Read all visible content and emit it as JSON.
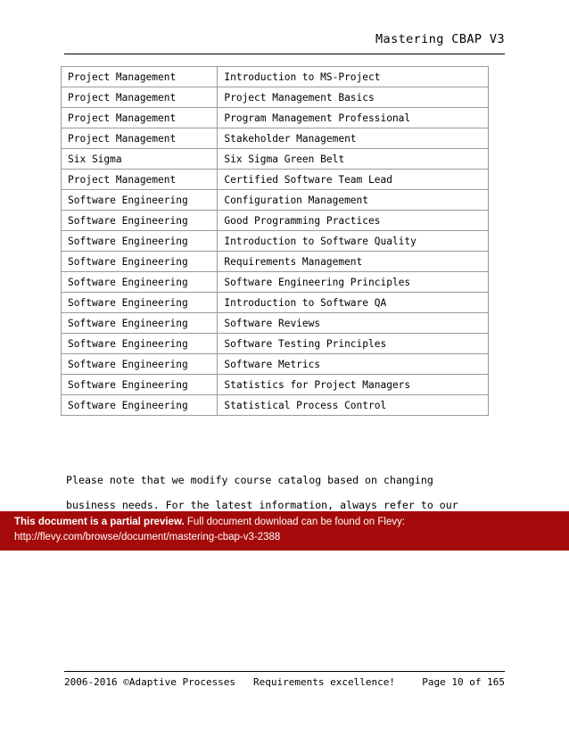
{
  "header": {
    "title": "Mastering CBAP V3"
  },
  "table": {
    "rows": [
      {
        "category": "Project Management",
        "course": "Introduction to MS-Project"
      },
      {
        "category": "Project Management",
        "course": "Project Management Basics"
      },
      {
        "category": "Project Management",
        "course": "Program Management Professional"
      },
      {
        "category": "Project Management",
        "course": "Stakeholder Management"
      },
      {
        "category": "Six Sigma",
        "course": "Six Sigma Green Belt"
      },
      {
        "category": "Project Management",
        "course": "Certified Software Team Lead"
      },
      {
        "category": "Software Engineering",
        "course": "Configuration Management"
      },
      {
        "category": "Software Engineering",
        "course": "Good Programming Practices"
      },
      {
        "category": "Software Engineering",
        "course": "Introduction to Software Quality"
      },
      {
        "category": "Software Engineering",
        "course": "Requirements Management"
      },
      {
        "category": "Software Engineering",
        "course": "Software Engineering Principles"
      },
      {
        "category": "Software Engineering",
        "course": "Introduction to Software QA"
      },
      {
        "category": "Software Engineering",
        "course": "Software Reviews"
      },
      {
        "category": "Software Engineering",
        "course": "Software Testing Principles"
      },
      {
        "category": "Software Engineering",
        "course": "Software Metrics"
      },
      {
        "category": "Software Engineering",
        "course": "Statistics for Project Managers"
      },
      {
        "category": "Software Engineering",
        "course": "Statistical Process Control"
      }
    ]
  },
  "note": {
    "line1": "Please note that we modify course catalog based on changing",
    "line2": "business needs. For the latest information, always refer to our"
  },
  "preview_banner": {
    "bold_text": "This document is a partial preview.",
    "rest_text": "Full document download can be found on Flevy:",
    "url": "http://flevy.com/browse/document/mastering-cbap-v3-2388",
    "background_color": "#a50a0a",
    "text_color": "#ffffff"
  },
  "footer": {
    "left": "2006-2016 ©Adaptive Processes",
    "middle": "Requirements excellence!",
    "right": "Page 10 of 165"
  }
}
